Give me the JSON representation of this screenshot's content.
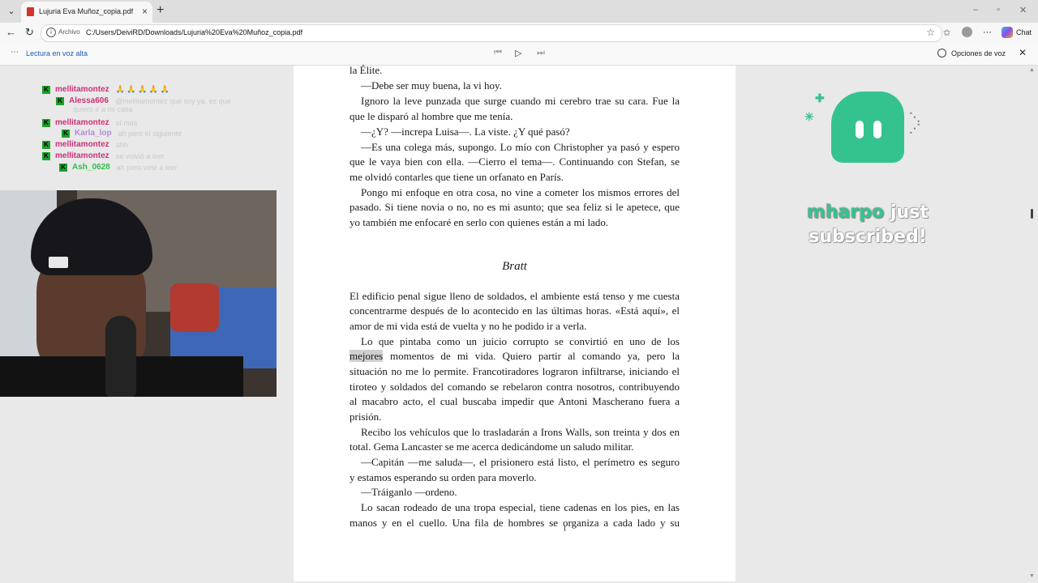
{
  "browser": {
    "tab_title": "Lujuria Eva Muñoz_copia.pdf",
    "address_chip": "Archivo",
    "url": "C:/Users/DeiviRD/Downloads/Lujuria%20Eva%20Muñoz_copia.pdf",
    "chat_label": "Chat"
  },
  "pdf_toolbar": {
    "read_aloud": "Lectura en voz alta",
    "voice_options": "Opciones de voz"
  },
  "pdf": {
    "lines": [
      "la Élite.",
      "—Debe ser muy buena, la vi hoy.",
      "Ignoro la leve punzada que surge cuando mi cerebro trae su cara. Fue la",
      "que le disparó al hombre que me tenía.",
      "—¿Y? —increpa Luisa—. La viste. ¿Y qué pasó?",
      "—Es una colega más, supongo. Lo mío con Christopher ya pasó y espero",
      "que le vaya bien con ella. —Cierro el tema—. Continuando con Stefan, se",
      "me olvidó contarles que tiene un orfanato en París.",
      "Pongo mi enfoque en otra cosa, no vine a cometer los mismos errores del",
      "pasado. Si tiene novia o no, no es mi asunto; que sea feliz si le apetece, que",
      "yo también me enfocaré en serlo con quienes están a mi lado.",
      "El edificio penal sigue lleno de soldados, el ambiente está tenso y me cuesta",
      "concentrarme después de lo acontecido en las últimas horas. «Está aquí», el",
      "amor de mi vida está de vuelta y no he podido ir a verla.",
      "Lo que pintaba como un juicio corrupto se convirtió en uno de los",
      "momentos de mi vida. Quiero partir al comando ya, pero la",
      "situación no me lo permite. Francotiradores lograron infiltrarse, iniciando el",
      "tiroteo y soldados del comando se rebelaron contra nosotros, contribuyendo",
      "al macabro acto, el cual buscaba impedir que Antoni Mascherano fuera a",
      "prisión.",
      "Recibo los vehículos que lo trasladarán a Irons Walls, son treinta y dos en",
      "total. Gema Lancaster se me acerca dedicándome un saludo militar.",
      "—Capitán —me saluda—, el prisionero está listo, el perímetro es seguro",
      "y estamos esperando su orden para moverlo.",
      "—Tráiganlo —ordeno.",
      "Lo sacan rodeado de una tropa especial, tiene cadenas en los pies, en las",
      "manos y en el cuello. Una fila de hombres se organiza a cada lado y su"
    ],
    "heading": "Bratt",
    "highlight_word": "mejores"
  },
  "stream_chat": [
    {
      "user": "mellitamontez",
      "color": "#d0307a",
      "text": "🙏 🙏 🙏 🙏 🙏"
    },
    {
      "user": "Alessa606",
      "color": "#d0307a",
      "text": "@mellitamontez que soy ya, es que"
    },
    {
      "user": "mellitamontez",
      "color": "#d0307a",
      "text": "sí mas"
    },
    {
      "user": "Karla_lop",
      "color": "#b58ad8",
      "text": "ah pero el siguiente"
    },
    {
      "user": "mellitamontez",
      "color": "#d0307a",
      "text": "ahh"
    },
    {
      "user": "mellitamontez",
      "color": "#d0307a",
      "text": "se volvió a leer"
    },
    {
      "user": "Ash_0628",
      "color": "#2fbf4a",
      "text": "ah pero vete a leer"
    }
  ],
  "stream_chat_wrap": "quiero ir a mi casa",
  "alert": {
    "user": "mharpo",
    "line1_rest": " just",
    "line2": "subscribed!"
  },
  "colors": {
    "alert_green": "#34c38f",
    "badge_green": "#1fa12c",
    "read_aloud_blue": "#1a5bb8"
  },
  "icons": [
    "tab-list-icon",
    "pdf-file-icon",
    "close-icon",
    "plus-icon",
    "back-icon",
    "refresh-icon",
    "info-icon",
    "star-icon",
    "favorites-icon",
    "profile-icon",
    "more-icon",
    "copilot-icon",
    "menu-icon",
    "skip-back-icon",
    "play-icon",
    "skip-forward-icon",
    "voice-options-icon"
  ]
}
